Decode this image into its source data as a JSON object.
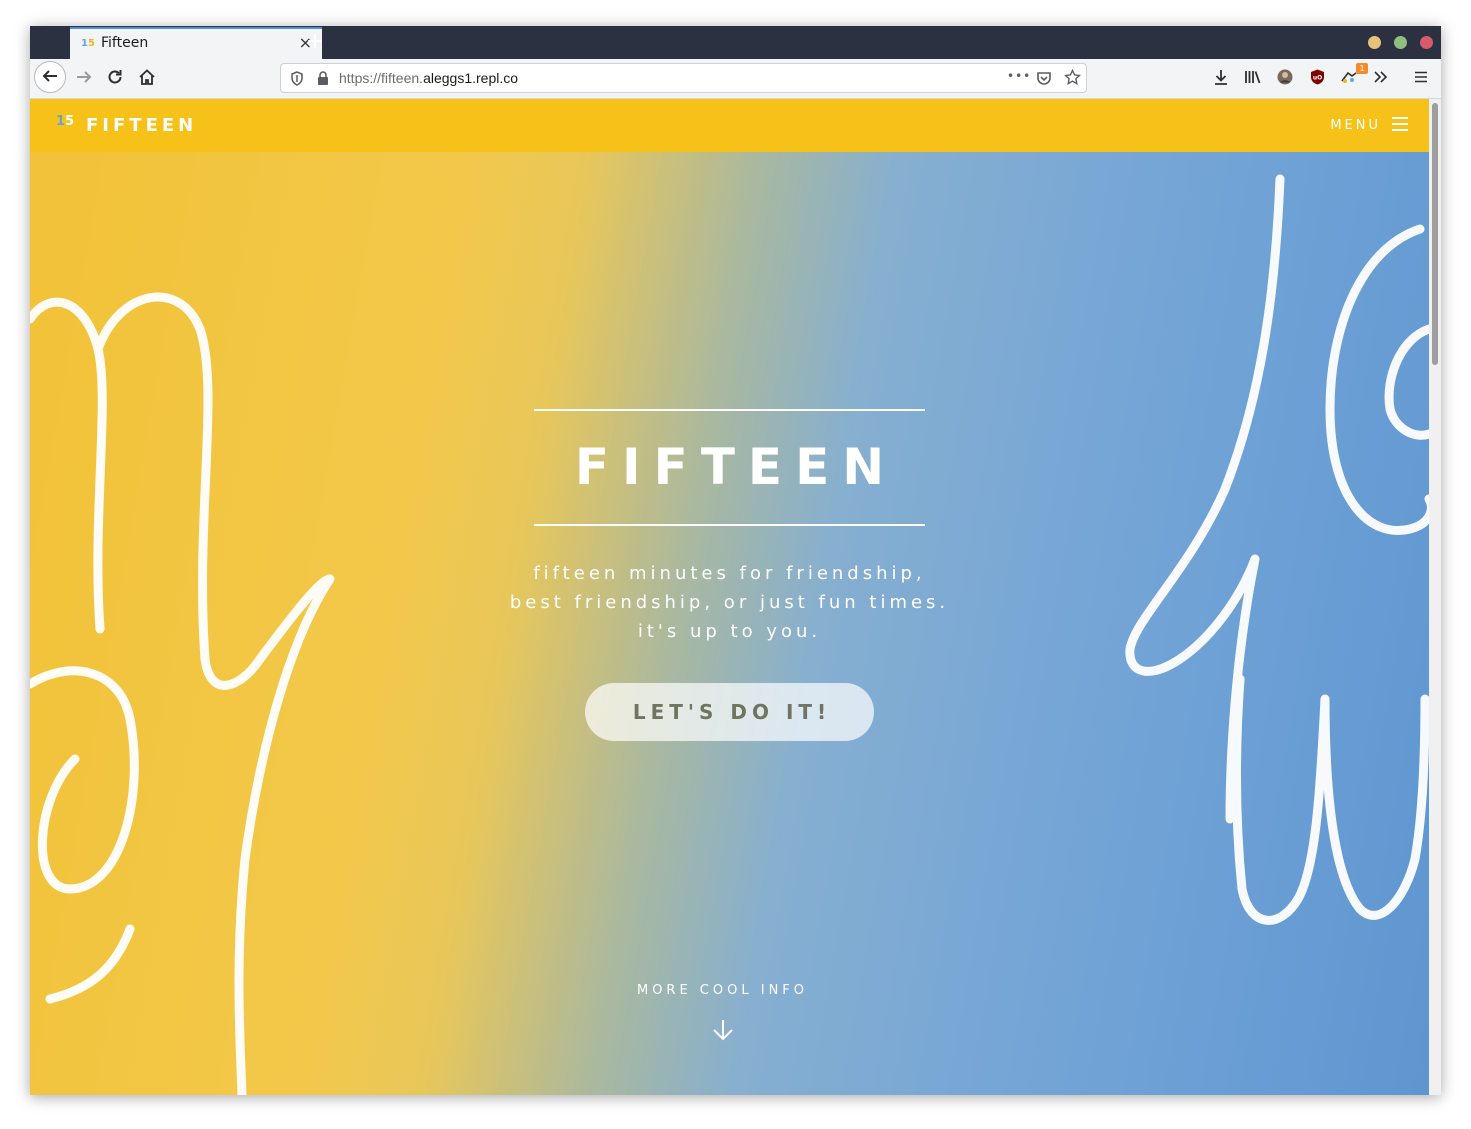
{
  "browser": {
    "tab_title": "Fifteen",
    "tab_close": "×",
    "new_tab": "+",
    "url_prefix": "https://fifteen.",
    "url_domain": "aleggs1.repl.co",
    "url_more": "•••",
    "extension_badge": "1",
    "icons": [
      "back-arrow-icon",
      "forward-arrow-icon",
      "reload-icon",
      "home-icon",
      "shield-icon",
      "lock-icon",
      "page-actions-icon",
      "pocket-icon",
      "bookmark-star-icon",
      "downloads-icon",
      "library-icon",
      "account-avatar-icon",
      "ublock-icon",
      "extension-icon",
      "overflow-chevron-icon",
      "hamburger-menu-icon"
    ],
    "window_controls": {
      "minimize": "#e8c07a",
      "maximize": "#8fbf7f",
      "close": "#d65a6a"
    }
  },
  "site": {
    "brand": "FIFTEEN",
    "logo_text": "15",
    "menu": "MENU",
    "colors": {
      "nav_bg": "#f6c119",
      "yellow": "#f2c237",
      "blue": "#6b9fd5"
    }
  },
  "hero": {
    "title": "FIFTEEN",
    "tagline_lines": [
      "fifteen minutes for friendship,",
      "best friendship, or just fun times.",
      "it's up to you."
    ],
    "cta": "LET'S DO IT!",
    "more_info": "MORE COOL INFO"
  }
}
